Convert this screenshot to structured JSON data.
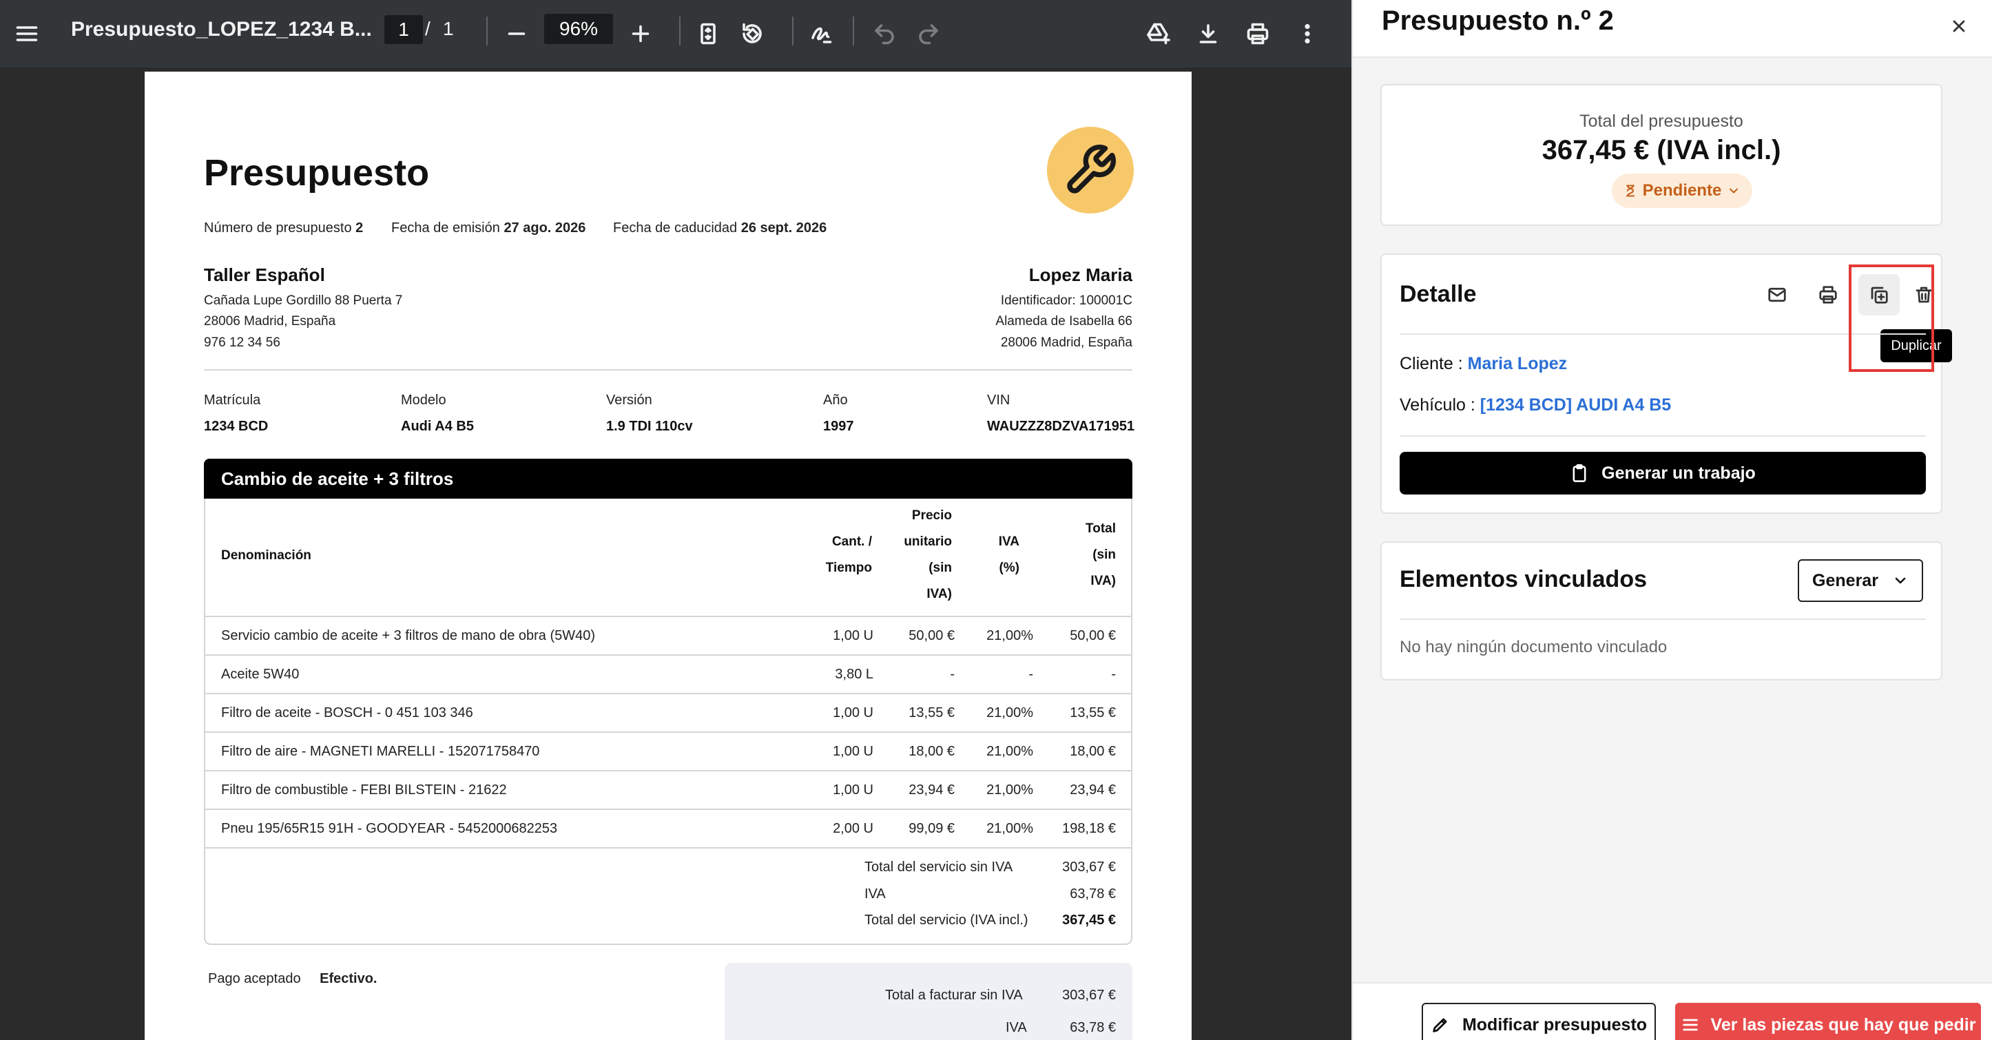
{
  "viewer": {
    "title": "Presupuesto_LOPEZ_1234 B...",
    "page_current": "1",
    "page_separator": "/",
    "page_total": "1",
    "zoom": "96%"
  },
  "doc": {
    "title": "Presupuesto",
    "meta": {
      "number_label": "Número de presupuesto",
      "number_value": "2",
      "issue_label": "Fecha de emisión",
      "issue_value": "27 ago. 2026",
      "expiry_label": "Fecha de caducidad",
      "expiry_value": "26 sept. 2026"
    },
    "shop": {
      "name": "Taller Español",
      "line1": "Cañada Lupe Gordillo 88 Puerta 7",
      "line2": "28006 Madrid, España",
      "line3": "976 12 34 56"
    },
    "client": {
      "name": "Lopez Maria",
      "line1": "Identificador: 100001C",
      "line2": "Alameda de Isabella 66",
      "line3": "28006 Madrid, España"
    },
    "vehicle": {
      "labels": [
        "Matrícula",
        "Modelo",
        "Versión",
        "Año",
        "VIN"
      ],
      "values": [
        "1234 BCD",
        "Audi A4 B5",
        "1.9 TDI 110cv",
        "1997",
        "WAUZZZ8DZVA171951"
      ]
    },
    "section_title": "Cambio de aceite + 3 filtros",
    "table": {
      "headers": {
        "name": "Denominación",
        "qty": [
          "Cant. /",
          "Tiempo"
        ],
        "price": [
          "Precio",
          "unitario",
          "(sin",
          "IVA)"
        ],
        "vat": [
          "IVA",
          "(%)"
        ],
        "total": [
          "Total",
          "(sin",
          "IVA)"
        ]
      },
      "rows": [
        {
          "name": "Servicio cambio de aceite + 3 filtros de mano de obra (5W40)",
          "qty": "1,00 U",
          "price": "50,00 €",
          "vat": "21,00%",
          "total": "50,00 €"
        },
        {
          "name": "Aceite 5W40",
          "qty": "3,80 L",
          "price": "-",
          "vat": "-",
          "total": "-"
        },
        {
          "name": "Filtro de aceite - BOSCH - 0 451 103 346",
          "qty": "1,00 U",
          "price": "13,55 €",
          "vat": "21,00%",
          "total": "13,55 €"
        },
        {
          "name": "Filtro de aire - MAGNETI MARELLI - 152071758470",
          "qty": "1,00 U",
          "price": "18,00 €",
          "vat": "21,00%",
          "total": "18,00 €"
        },
        {
          "name": "Filtro de combustible - FEBI BILSTEIN - 21622",
          "qty": "1,00 U",
          "price": "23,94 €",
          "vat": "21,00%",
          "total": "23,94 €"
        },
        {
          "name": "Pneu 195/65R15 91H - GOODYEAR - 5452000682253",
          "qty": "2,00 U",
          "price": "99,09 €",
          "vat": "21,00%",
          "total": "198,18 €"
        }
      ],
      "totals": [
        {
          "label": "Total del servicio sin IVA",
          "value": "303,67 €"
        },
        {
          "label": "IVA",
          "value": "63,78 €"
        },
        {
          "label": "Total del servicio (IVA incl.)",
          "value": "367,45 €"
        }
      ]
    },
    "payment_label": "Pago aceptado",
    "payment_value": "Efectivo.",
    "summary": [
      {
        "label": "Total a facturar sin IVA",
        "value": "303,67 €"
      },
      {
        "label": "IVA",
        "value": "63,78 €"
      }
    ]
  },
  "panel": {
    "title": "Presupuesto n.º 2",
    "total_label": "Total del presupuesto",
    "total_value": "367,45 € (IVA incl.)",
    "status": "Pendiente",
    "detail_title": "Detalle",
    "tooltip": "Duplicar",
    "client_label": "Cliente :",
    "client_value": "Maria Lopez",
    "vehicle_label": "Vehículo :",
    "vehicle_value": "[1234 BCD] AUDI A4 B5",
    "generate_job": "Generar un trabajo",
    "linked_title": "Elementos vinculados",
    "generate_dropdown": "Generar",
    "linked_empty": "No hay ningún documento vinculado",
    "edit_button": "Modificar presupuesto",
    "parts_button": "Ver las piezas que hay que pedir"
  },
  "colors": {
    "accent_link": "#2b6fd6",
    "status_bg": "#fdecd9",
    "status_text": "#c4601a",
    "danger": "#e84a4a",
    "logo": "#f6c86a"
  }
}
